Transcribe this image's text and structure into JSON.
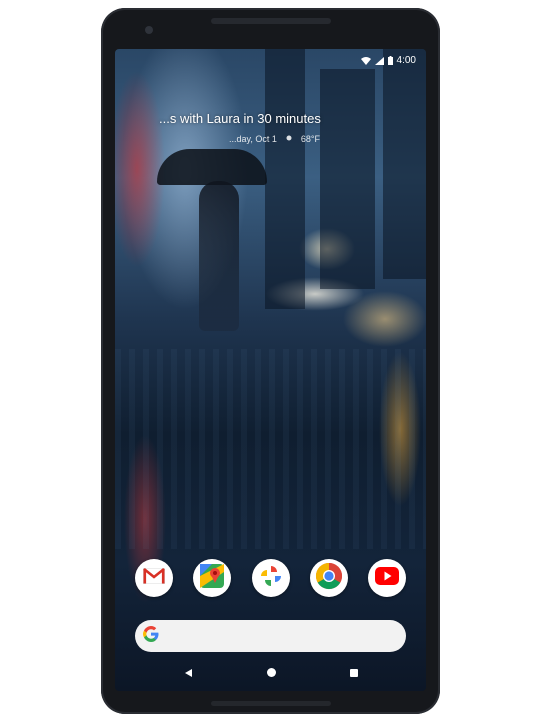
{
  "glance": {
    "event": "...s with Laura in 30 minutes",
    "date": "...day, Oct 1",
    "weather": "68°F"
  },
  "status": {
    "time": "4:00"
  },
  "dock_apps": [
    {
      "name": "Gmail",
      "icon": "gmail-icon"
    },
    {
      "name": "Maps",
      "icon": "maps-icon"
    },
    {
      "name": "Photos",
      "icon": "photos-icon"
    },
    {
      "name": "Chrome",
      "icon": "chrome-icon"
    },
    {
      "name": "YouTube",
      "icon": "youtube-icon"
    }
  ],
  "search": {
    "placeholder": ""
  },
  "colors": {
    "frame": "#16181c",
    "search_bg": "#f2f2f2"
  }
}
